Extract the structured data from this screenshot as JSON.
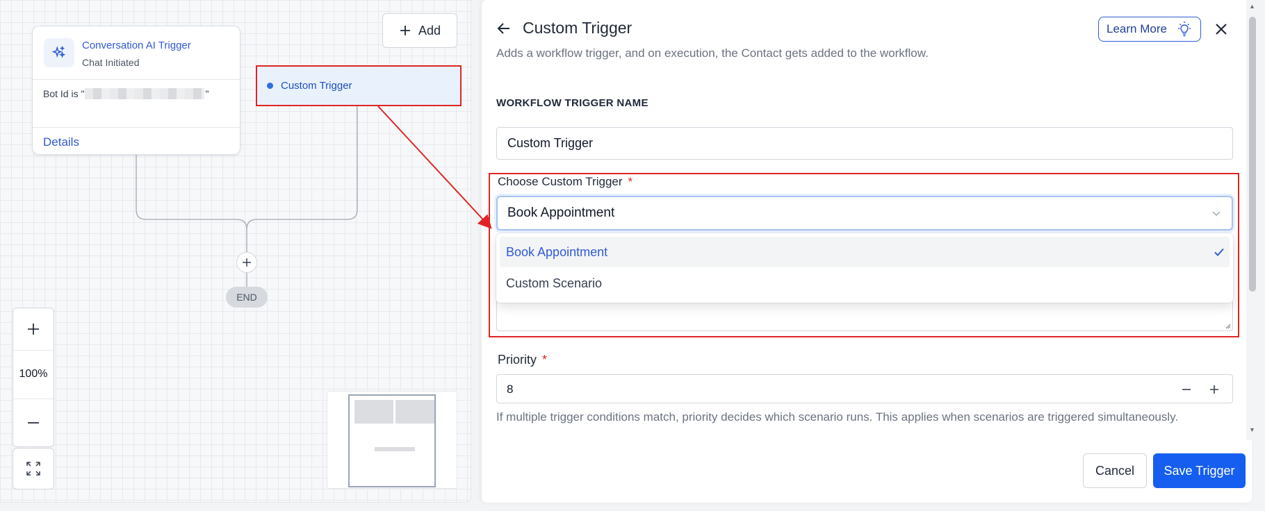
{
  "canvas": {
    "trigger_node": {
      "title": "Conversation AI Trigger",
      "subtitle": "Chat Initiated",
      "condition_prefix": "Bot Id is \"",
      "condition_suffix": "\"",
      "details_link": "Details",
      "icon": "sparkle-icon"
    },
    "custom_trigger_node": {
      "label": "Custom Trigger"
    },
    "add_button": {
      "label": "Add",
      "icon": "plus-icon"
    },
    "end_node": {
      "label": "END"
    },
    "zoom": {
      "level": "100%"
    }
  },
  "panel": {
    "title": "Custom Trigger",
    "description": "Adds a workflow trigger, and on execution, the Contact gets added to the workflow.",
    "learn_more": "Learn More",
    "trigger_name_label": "WORKFLOW TRIGGER NAME",
    "trigger_name_value": "Custom Trigger",
    "choose_label": "Choose Custom Trigger",
    "required_mark": "*",
    "selected_value": "Book Appointment",
    "options": [
      {
        "label": "Book Appointment",
        "selected": true
      },
      {
        "label": "Custom Scenario",
        "selected": false
      }
    ],
    "priority_label": "Priority",
    "priority_value": "8",
    "priority_help": "If multiple trigger conditions match, priority decides which scenario runs. This applies when scenarios are triggered simultaneously.",
    "cancel_label": "Cancel",
    "save_label": "Save Trigger"
  },
  "colors": {
    "accent": "#155eef",
    "link": "#2f5bd6",
    "highlight_red": "#e02424",
    "required_red": "#dc2626"
  }
}
